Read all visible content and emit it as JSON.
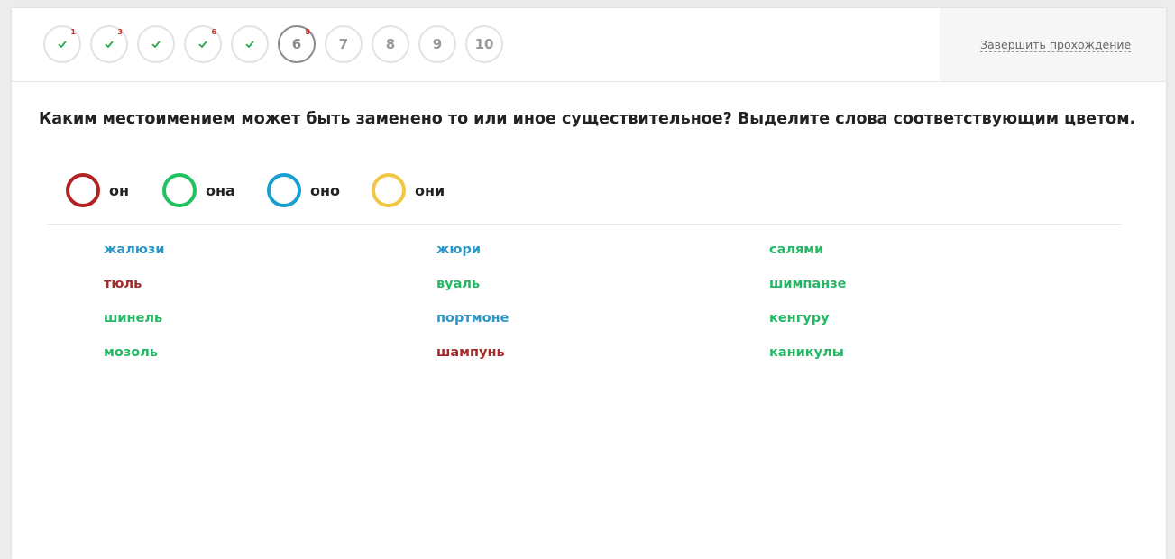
{
  "colors": {
    "он": "#b22222",
    "она": "#1fc25f",
    "оно": "#1a9fd1",
    "они": "#f2c744"
  },
  "steps": [
    {
      "label": "",
      "state": "done",
      "badge": "1"
    },
    {
      "label": "",
      "state": "done",
      "badge": "3"
    },
    {
      "label": "",
      "state": "done",
      "badge": ""
    },
    {
      "label": "",
      "state": "done",
      "badge": "6"
    },
    {
      "label": "",
      "state": "done",
      "badge": ""
    },
    {
      "label": "6",
      "state": "current",
      "badge": "8"
    },
    {
      "label": "7",
      "state": "todo",
      "badge": ""
    },
    {
      "label": "8",
      "state": "todo",
      "badge": ""
    },
    {
      "label": "9",
      "state": "todo",
      "badge": ""
    },
    {
      "label": "10",
      "state": "todo",
      "badge": ""
    }
  ],
  "finish_label": "Завершить прохождение",
  "question": "Каким местоимением может быть заменено то или иное существительное? Выделите слова соответствующим цветом.",
  "legend": [
    {
      "label": "он",
      "color": "#b22222"
    },
    {
      "label": "она",
      "color": "#1fc25f"
    },
    {
      "label": "оно",
      "color": "#1a9fd1"
    },
    {
      "label": "они",
      "color": "#f2c744"
    }
  ],
  "words": [
    [
      {
        "text": "жалюзи",
        "color": "#2a97c9"
      },
      {
        "text": "тюль",
        "color": "#a52a2a"
      },
      {
        "text": "шинель",
        "color": "#25b765"
      },
      {
        "text": "мозоль",
        "color": "#25b765"
      }
    ],
    [
      {
        "text": "жюри",
        "color": "#2a97c9"
      },
      {
        "text": "вуаль",
        "color": "#25b765"
      },
      {
        "text": "портмоне",
        "color": "#2a97c9"
      },
      {
        "text": "шампунь",
        "color": "#a52a2a"
      }
    ],
    [
      {
        "text": "салями",
        "color": "#25b765"
      },
      {
        "text": "шимпанзе",
        "color": "#25b765"
      },
      {
        "text": "кенгуру",
        "color": "#25b765"
      },
      {
        "text": "каникулы",
        "color": "#25b765"
      }
    ]
  ]
}
